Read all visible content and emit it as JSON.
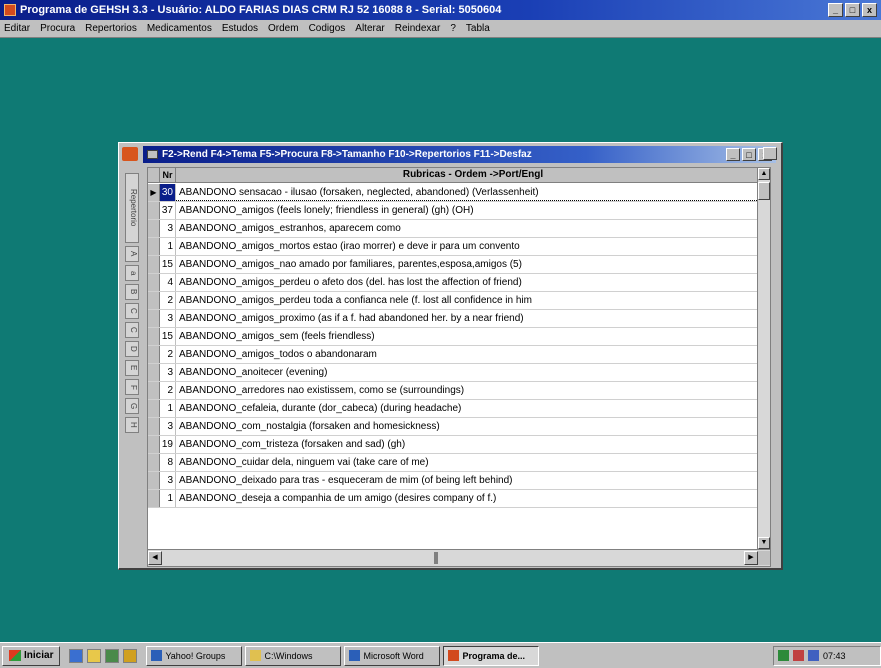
{
  "app": {
    "title": "Programa de GEHSH 3.3 - Usuário: ALDO FARIAS DIAS CRM RJ 52 16088 8 - Serial: 5050604",
    "window_controls": [
      "_",
      "□",
      "x"
    ]
  },
  "menu": [
    "Editar",
    "Procura",
    "Repertorios",
    "Medicamentos",
    "Estudos",
    "Ordem",
    "Codigos",
    "Alterar",
    "Reindexar",
    "?",
    "Tabla"
  ],
  "child_window": {
    "title": "F2->Rend F4->Tema F5->Procura F8->Tamanho F10->Repertorios F11->Desfaz",
    "controls": [
      "_",
      "□",
      "x"
    ]
  },
  "grid": {
    "columns": [
      "Nr",
      "Rubricas - Ordem ->Port/Engl"
    ],
    "rows": [
      {
        "n": "30",
        "text": "ABANDONO sensacao - ilusao (forsaken, neglected, abandoned) (Verlassenheit)"
      },
      {
        "n": "37",
        "text": "ABANDONO_amigos (feels lonely; friendless in general) (gh) (OH)"
      },
      {
        "n": "3",
        "text": "ABANDONO_amigos_estranhos, aparecem como"
      },
      {
        "n": "1",
        "text": "ABANDONO_amigos_mortos estao (irao morrer) e deve ir para um convento"
      },
      {
        "n": "15",
        "text": "ABANDONO_amigos_nao amado por familiares, parentes,esposa,amigos (5)"
      },
      {
        "n": "4",
        "text": "ABANDONO_amigos_perdeu o afeto dos (del. has lost the affection of friend)"
      },
      {
        "n": "2",
        "text": "ABANDONO_amigos_perdeu toda a confianca nele (f. lost all confidence in him"
      },
      {
        "n": "3",
        "text": "ABANDONO_amigos_proximo (as if a f. had abandoned her. by a near friend)"
      },
      {
        "n": "15",
        "text": "ABANDONO_amigos_sem (feels friendless)"
      },
      {
        "n": "2",
        "text": "ABANDONO_amigos_todos o abandonaram"
      },
      {
        "n": "3",
        "text": "ABANDONO_anoitecer (evening)"
      },
      {
        "n": "2",
        "text": "ABANDONO_arredores nao existissem, como se (surroundings)"
      },
      {
        "n": "1",
        "text": "ABANDONO_cefaleia, durante (dor_cabeca) (during headache)"
      },
      {
        "n": "3",
        "text": "ABANDONO_com_nostalgia (forsaken and homesickness)"
      },
      {
        "n": "19",
        "text": "ABANDONO_com_tristeza (forsaken and sad) (gh)"
      },
      {
        "n": "8",
        "text": "ABANDONO_cuidar dela, ninguem vai (take care of me)"
      },
      {
        "n": "3",
        "text": "ABANDONO_deixado para tras - esqueceram de mim (of being left behind)"
      },
      {
        "n": "1",
        "text": "ABANDONO_deseja a companhia de um amigo (desires company of f.)"
      }
    ]
  },
  "side_tabs": [
    "Repertorio",
    "A",
    "a",
    "B",
    "C",
    "C",
    "D",
    "E",
    "F",
    "G",
    "H"
  ],
  "taskbar": {
    "start_label": "Iniciar",
    "tasks": [
      {
        "label": "Yahoo! Groups",
        "active": false
      },
      {
        "label": "C:\\Windows",
        "active": false
      },
      {
        "label": "Microsoft Word",
        "active": false
      },
      {
        "label": "Programa de...",
        "active": true
      }
    ],
    "clock": "07:43"
  }
}
